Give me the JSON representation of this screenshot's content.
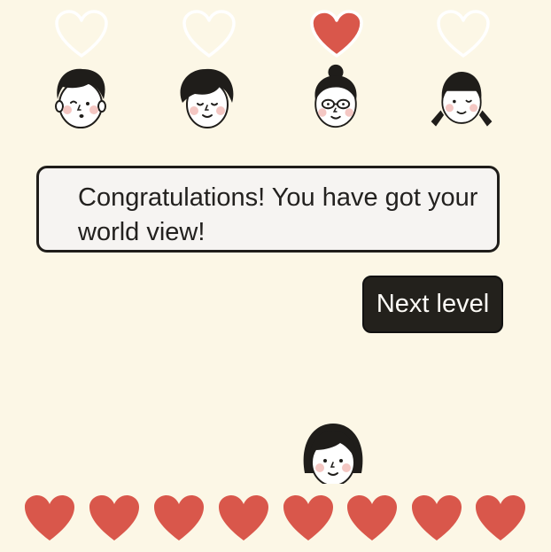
{
  "message": {
    "text": "Congratulations! You have got your world view!"
  },
  "next_button": {
    "label": "Next level"
  },
  "characters": [
    {
      "name": "father-face",
      "heart": "empty"
    },
    {
      "name": "mother-face",
      "heart": "empty"
    },
    {
      "name": "grandma-face",
      "heart": "filled"
    },
    {
      "name": "girl-face",
      "heart": "empty"
    }
  ],
  "lives": {
    "count": 8
  },
  "colors": {
    "background": "#fcf7e6",
    "heart_red": "#d9574b",
    "empty_heart_outline": "#ffffff",
    "button": "#23211c",
    "ink": "#1f1d1a",
    "blush": "#f4c7c3"
  },
  "icons": {
    "empty_heart": "heart-outline-icon",
    "filled_heart": "heart-filled-icon",
    "life": "heart-life-icon"
  }
}
